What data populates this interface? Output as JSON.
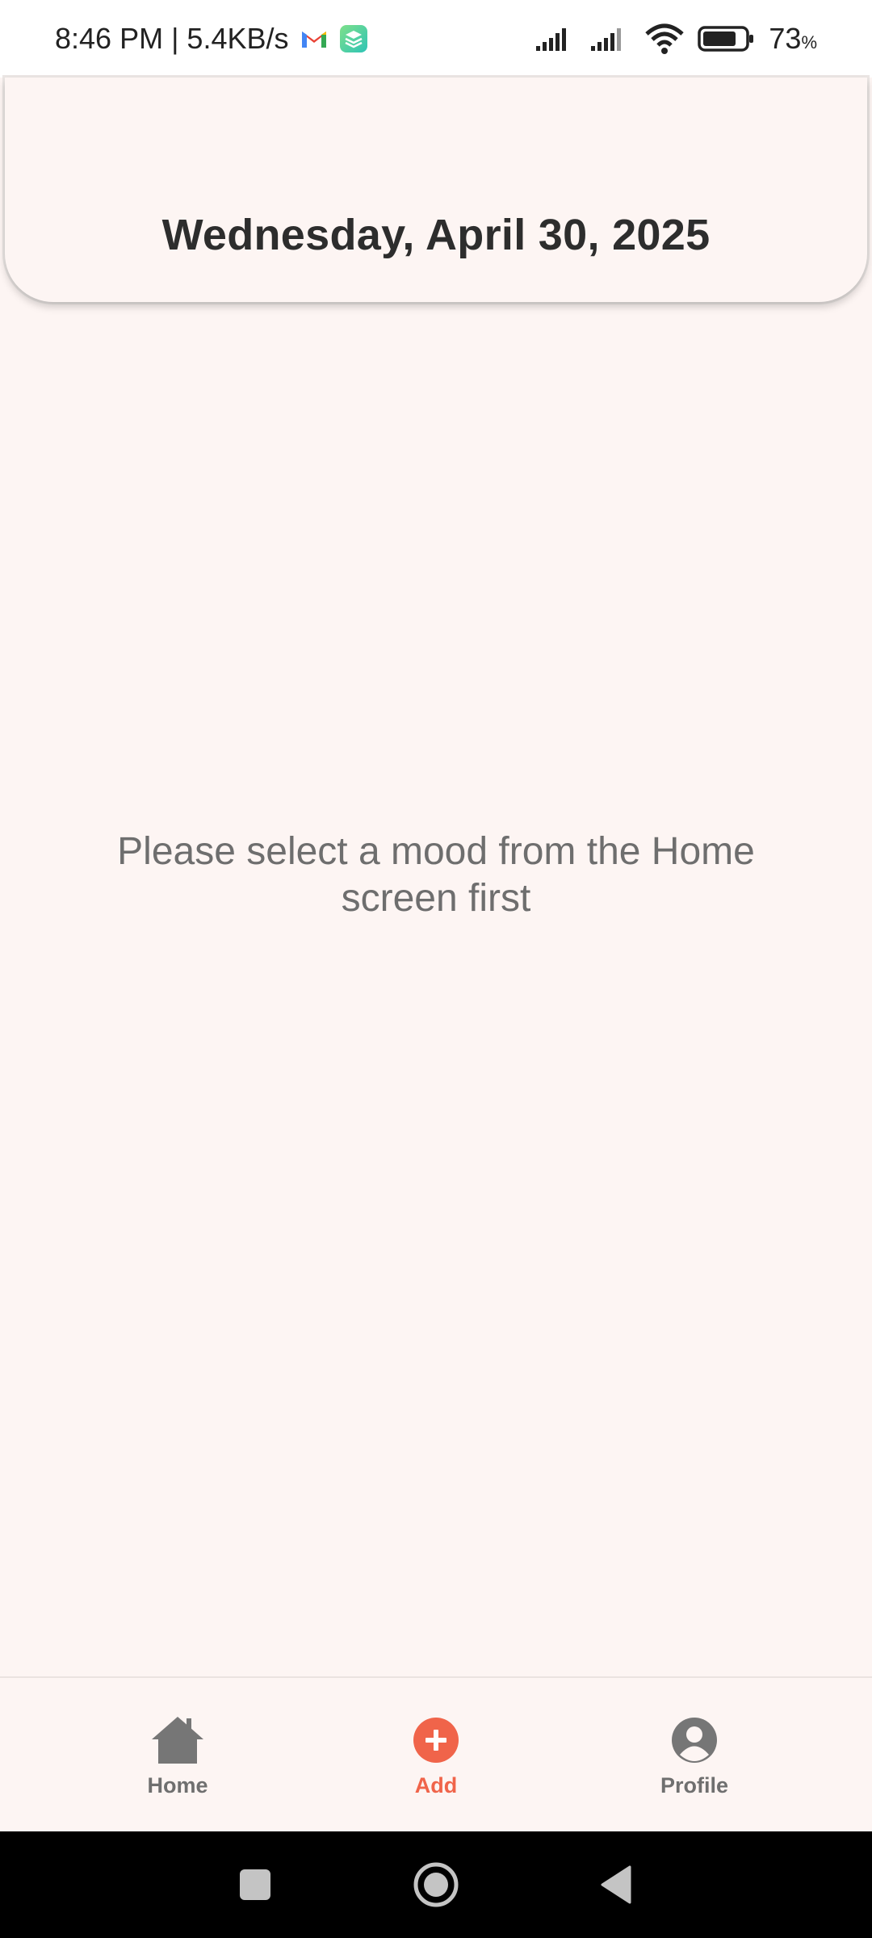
{
  "status_bar": {
    "time_speed": "8:46 PM | 5.4KB/s",
    "battery_percent": "73",
    "battery_unit": "%",
    "icons": [
      "gmail-icon",
      "app-layers-icon",
      "signal-icon",
      "signal-icon",
      "wifi-icon",
      "battery-icon"
    ]
  },
  "header": {
    "date": "Wednesday, April 30, 2025"
  },
  "main": {
    "empty_message": "Please select a mood from the Home screen first"
  },
  "bottom_nav": {
    "items": [
      {
        "label": "Home",
        "icon": "home-icon",
        "active": false
      },
      {
        "label": "Add",
        "icon": "add-circle-icon",
        "active": true
      },
      {
        "label": "Profile",
        "icon": "profile-icon",
        "active": false
      }
    ]
  },
  "colors": {
    "background": "#fdf5f3",
    "accent": "#f0644a",
    "inactive": "#6f6f6f",
    "text_dark": "#2d2d2d"
  }
}
